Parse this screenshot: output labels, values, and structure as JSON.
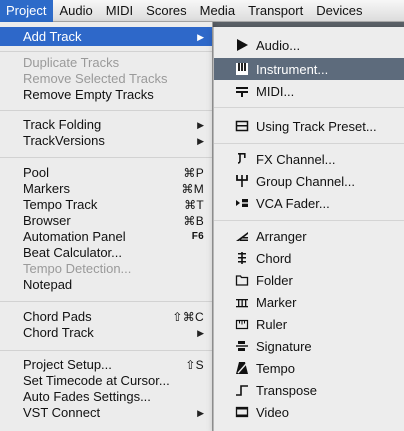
{
  "menubar": {
    "items": [
      {
        "label": "Project",
        "active": true
      },
      {
        "label": "Audio"
      },
      {
        "label": "MIDI"
      },
      {
        "label": "Scores"
      },
      {
        "label": "Media"
      },
      {
        "label": "Transport"
      },
      {
        "label": "Devices"
      }
    ]
  },
  "project_menu": {
    "add_track": {
      "label": "Add Track"
    },
    "duplicate_tracks": {
      "label": "Duplicate Tracks"
    },
    "remove_selected_tracks": {
      "label": "Remove Selected Tracks"
    },
    "remove_empty_tracks": {
      "label": "Remove Empty Tracks"
    },
    "track_folding": {
      "label": "Track Folding"
    },
    "track_versions": {
      "label": "TrackVersions"
    },
    "pool": {
      "label": "Pool",
      "shortcut": "⌘P"
    },
    "markers": {
      "label": "Markers",
      "shortcut": "⌘M"
    },
    "tempo_track": {
      "label": "Tempo Track",
      "shortcut": "⌘T"
    },
    "browser": {
      "label": "Browser",
      "shortcut": "⌘B"
    },
    "automation_panel": {
      "label": "Automation Panel",
      "shortcut": "F6"
    },
    "beat_calculator": {
      "label": "Beat Calculator..."
    },
    "tempo_detection": {
      "label": "Tempo Detection..."
    },
    "notepad": {
      "label": "Notepad"
    },
    "chord_pads": {
      "label": "Chord Pads",
      "shortcut": "⇧⌘C"
    },
    "chord_track": {
      "label": "Chord Track"
    },
    "project_setup": {
      "label": "Project Setup...",
      "shortcut": "⇧S"
    },
    "set_timecode": {
      "label": "Set Timecode at Cursor..."
    },
    "auto_fades": {
      "label": "Auto Fades Settings..."
    },
    "vst_connect": {
      "label": "VST Connect"
    }
  },
  "add_track_submenu": {
    "items": [
      {
        "label": "Audio...",
        "icon": "audio-track-icon"
      },
      {
        "label": "Instrument...",
        "icon": "instrument-track-icon"
      },
      {
        "label": "MIDI...",
        "icon": "midi-track-icon"
      },
      {
        "label": "Using Track Preset...",
        "icon": "track-preset-icon"
      },
      {
        "label": "FX Channel...",
        "icon": "fx-channel-icon"
      },
      {
        "label": "Group Channel...",
        "icon": "group-channel-icon"
      },
      {
        "label": "VCA Fader...",
        "icon": "vca-fader-icon"
      },
      {
        "label": "Arranger",
        "icon": "arranger-icon"
      },
      {
        "label": "Chord",
        "icon": "chord-icon"
      },
      {
        "label": "Folder",
        "icon": "folder-icon"
      },
      {
        "label": "Marker",
        "icon": "marker-icon"
      },
      {
        "label": "Ruler",
        "icon": "ruler-icon"
      },
      {
        "label": "Signature",
        "icon": "signature-icon"
      },
      {
        "label": "Tempo",
        "icon": "tempo-icon"
      },
      {
        "label": "Transpose",
        "icon": "transpose-icon"
      },
      {
        "label": "Video",
        "icon": "video-icon"
      }
    ]
  },
  "colors": {
    "menubar_highlight": "#2d6bc9",
    "menu_highlight": "#2e68c9",
    "submenu_highlight": "#5d6b7c",
    "disabled_text": "#9a9a9a"
  }
}
